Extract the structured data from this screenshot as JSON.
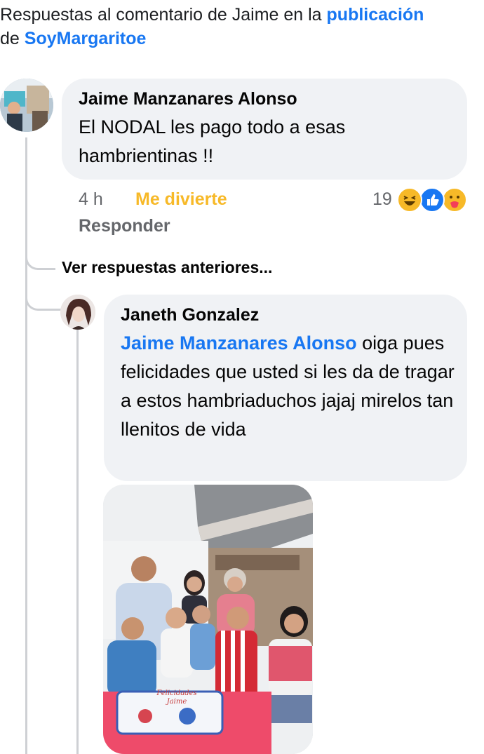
{
  "header": {
    "prefix": "Respuestas al comentario de Jaime en la ",
    "link1": "publicación",
    "de": "de ",
    "link2": "SoyMargaritoe"
  },
  "comment": {
    "author": "Jaime Manzanares Alonso",
    "text": "El NODAL  les pago todo a esas hambrientinas !!",
    "time": "4 h",
    "reaction_label": "Me divierte",
    "reply_label": "Responder",
    "reaction_count": "19"
  },
  "see_previous": "Ver respuestas anteriores...",
  "reply": {
    "author": "Janeth Gonzalez",
    "mention": "Jaime Manzanares Alonso",
    "text": " oiga pues felicidades que usted si les da de tragar a estos hambriaduchos jajaj mirelos tan llenitos de vida"
  },
  "photo": {
    "cake_line1": "Felicidades",
    "cake_line2": "Jaime"
  }
}
